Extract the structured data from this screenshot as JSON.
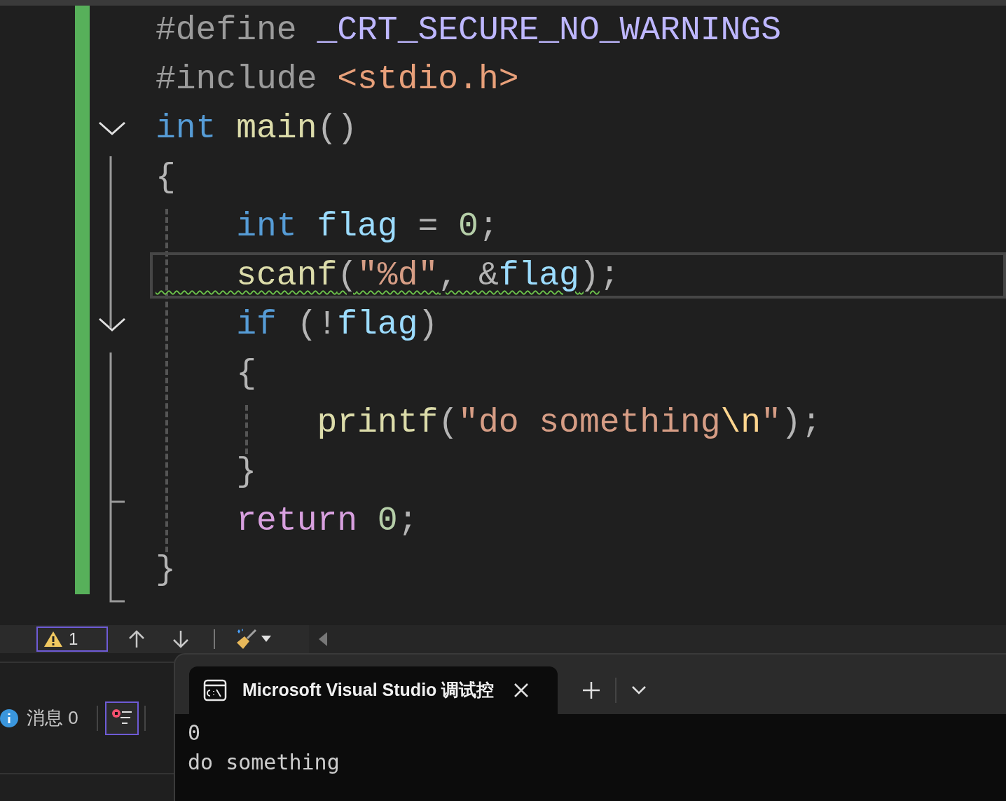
{
  "editor": {
    "lines": [
      {
        "changed": true,
        "fold": false,
        "current": false,
        "warning": false,
        "tokens": [
          {
            "text": "#define ",
            "kind": "preproc"
          },
          {
            "text": "_CRT_SECURE_NO_WARNINGS",
            "kind": "macro"
          }
        ]
      },
      {
        "changed": true,
        "fold": false,
        "current": false,
        "warning": false,
        "tokens": [
          {
            "text": "#include ",
            "kind": "preproc"
          },
          {
            "text": "<stdio.h>",
            "kind": "header"
          }
        ]
      },
      {
        "changed": true,
        "fold": true,
        "current": false,
        "warning": false,
        "tokens": [
          {
            "text": "int ",
            "kind": "keyword"
          },
          {
            "text": "main",
            "kind": "function"
          },
          {
            "text": "()",
            "kind": "punct"
          }
        ]
      },
      {
        "changed": true,
        "fold": false,
        "current": false,
        "warning": false,
        "tokens": [
          {
            "text": "{",
            "kind": "punct"
          }
        ]
      },
      {
        "changed": true,
        "fold": false,
        "current": false,
        "warning": false,
        "tokens": [
          {
            "text": "    int ",
            "kind": "keyword"
          },
          {
            "text": "flag",
            "kind": "variable"
          },
          {
            "text": " = ",
            "kind": "punct"
          },
          {
            "text": "0",
            "kind": "number"
          },
          {
            "text": ";",
            "kind": "punct"
          }
        ]
      },
      {
        "changed": true,
        "fold": false,
        "current": true,
        "warning": true,
        "tokens": [
          {
            "text": "    scanf",
            "kind": "function"
          },
          {
            "text": "(",
            "kind": "punct"
          },
          {
            "text": "\"%d\"",
            "kind": "string"
          },
          {
            "text": ", &",
            "kind": "punct"
          },
          {
            "text": "flag",
            "kind": "variable"
          },
          {
            "text": ")",
            "kind": "punct"
          },
          {
            "text": ";",
            "kind": "punct"
          }
        ]
      },
      {
        "changed": true,
        "fold": true,
        "current": false,
        "warning": false,
        "tokens": [
          {
            "text": "    if ",
            "kind": "keyword"
          },
          {
            "text": "(!",
            "kind": "punct"
          },
          {
            "text": "flag",
            "kind": "variable"
          },
          {
            "text": ")",
            "kind": "punct"
          }
        ]
      },
      {
        "changed": true,
        "fold": false,
        "current": false,
        "warning": false,
        "tokens": [
          {
            "text": "    {",
            "kind": "punct"
          }
        ]
      },
      {
        "changed": true,
        "fold": false,
        "current": false,
        "warning": false,
        "tokens": [
          {
            "text": "        printf",
            "kind": "function"
          },
          {
            "text": "(",
            "kind": "punct"
          },
          {
            "text": "\"do something",
            "kind": "string"
          },
          {
            "text": "\\n",
            "kind": "escape"
          },
          {
            "text": "\"",
            "kind": "string"
          },
          {
            "text": ");",
            "kind": "punct"
          }
        ]
      },
      {
        "changed": true,
        "fold": false,
        "current": false,
        "warning": false,
        "tokens": [
          {
            "text": "    }",
            "kind": "punct"
          }
        ]
      },
      {
        "changed": true,
        "fold": false,
        "current": false,
        "warning": false,
        "tokens": [
          {
            "text": "    return ",
            "kind": "control"
          },
          {
            "text": "0",
            "kind": "number"
          },
          {
            "text": ";",
            "kind": "punct"
          }
        ]
      },
      {
        "changed": true,
        "fold": false,
        "current": false,
        "warning": false,
        "tokens": [
          {
            "text": "}",
            "kind": "punct"
          }
        ]
      }
    ]
  },
  "error_list_toolbar": {
    "warnings": {
      "count": "1",
      "selected": true
    }
  },
  "output_panel": {
    "messages": {
      "label": "消息 0"
    },
    "filter": {
      "selected": true
    }
  },
  "terminal": {
    "tab": {
      "title": "Microsoft Visual Studio 调试控"
    },
    "output": [
      "0",
      "do something"
    ]
  }
}
